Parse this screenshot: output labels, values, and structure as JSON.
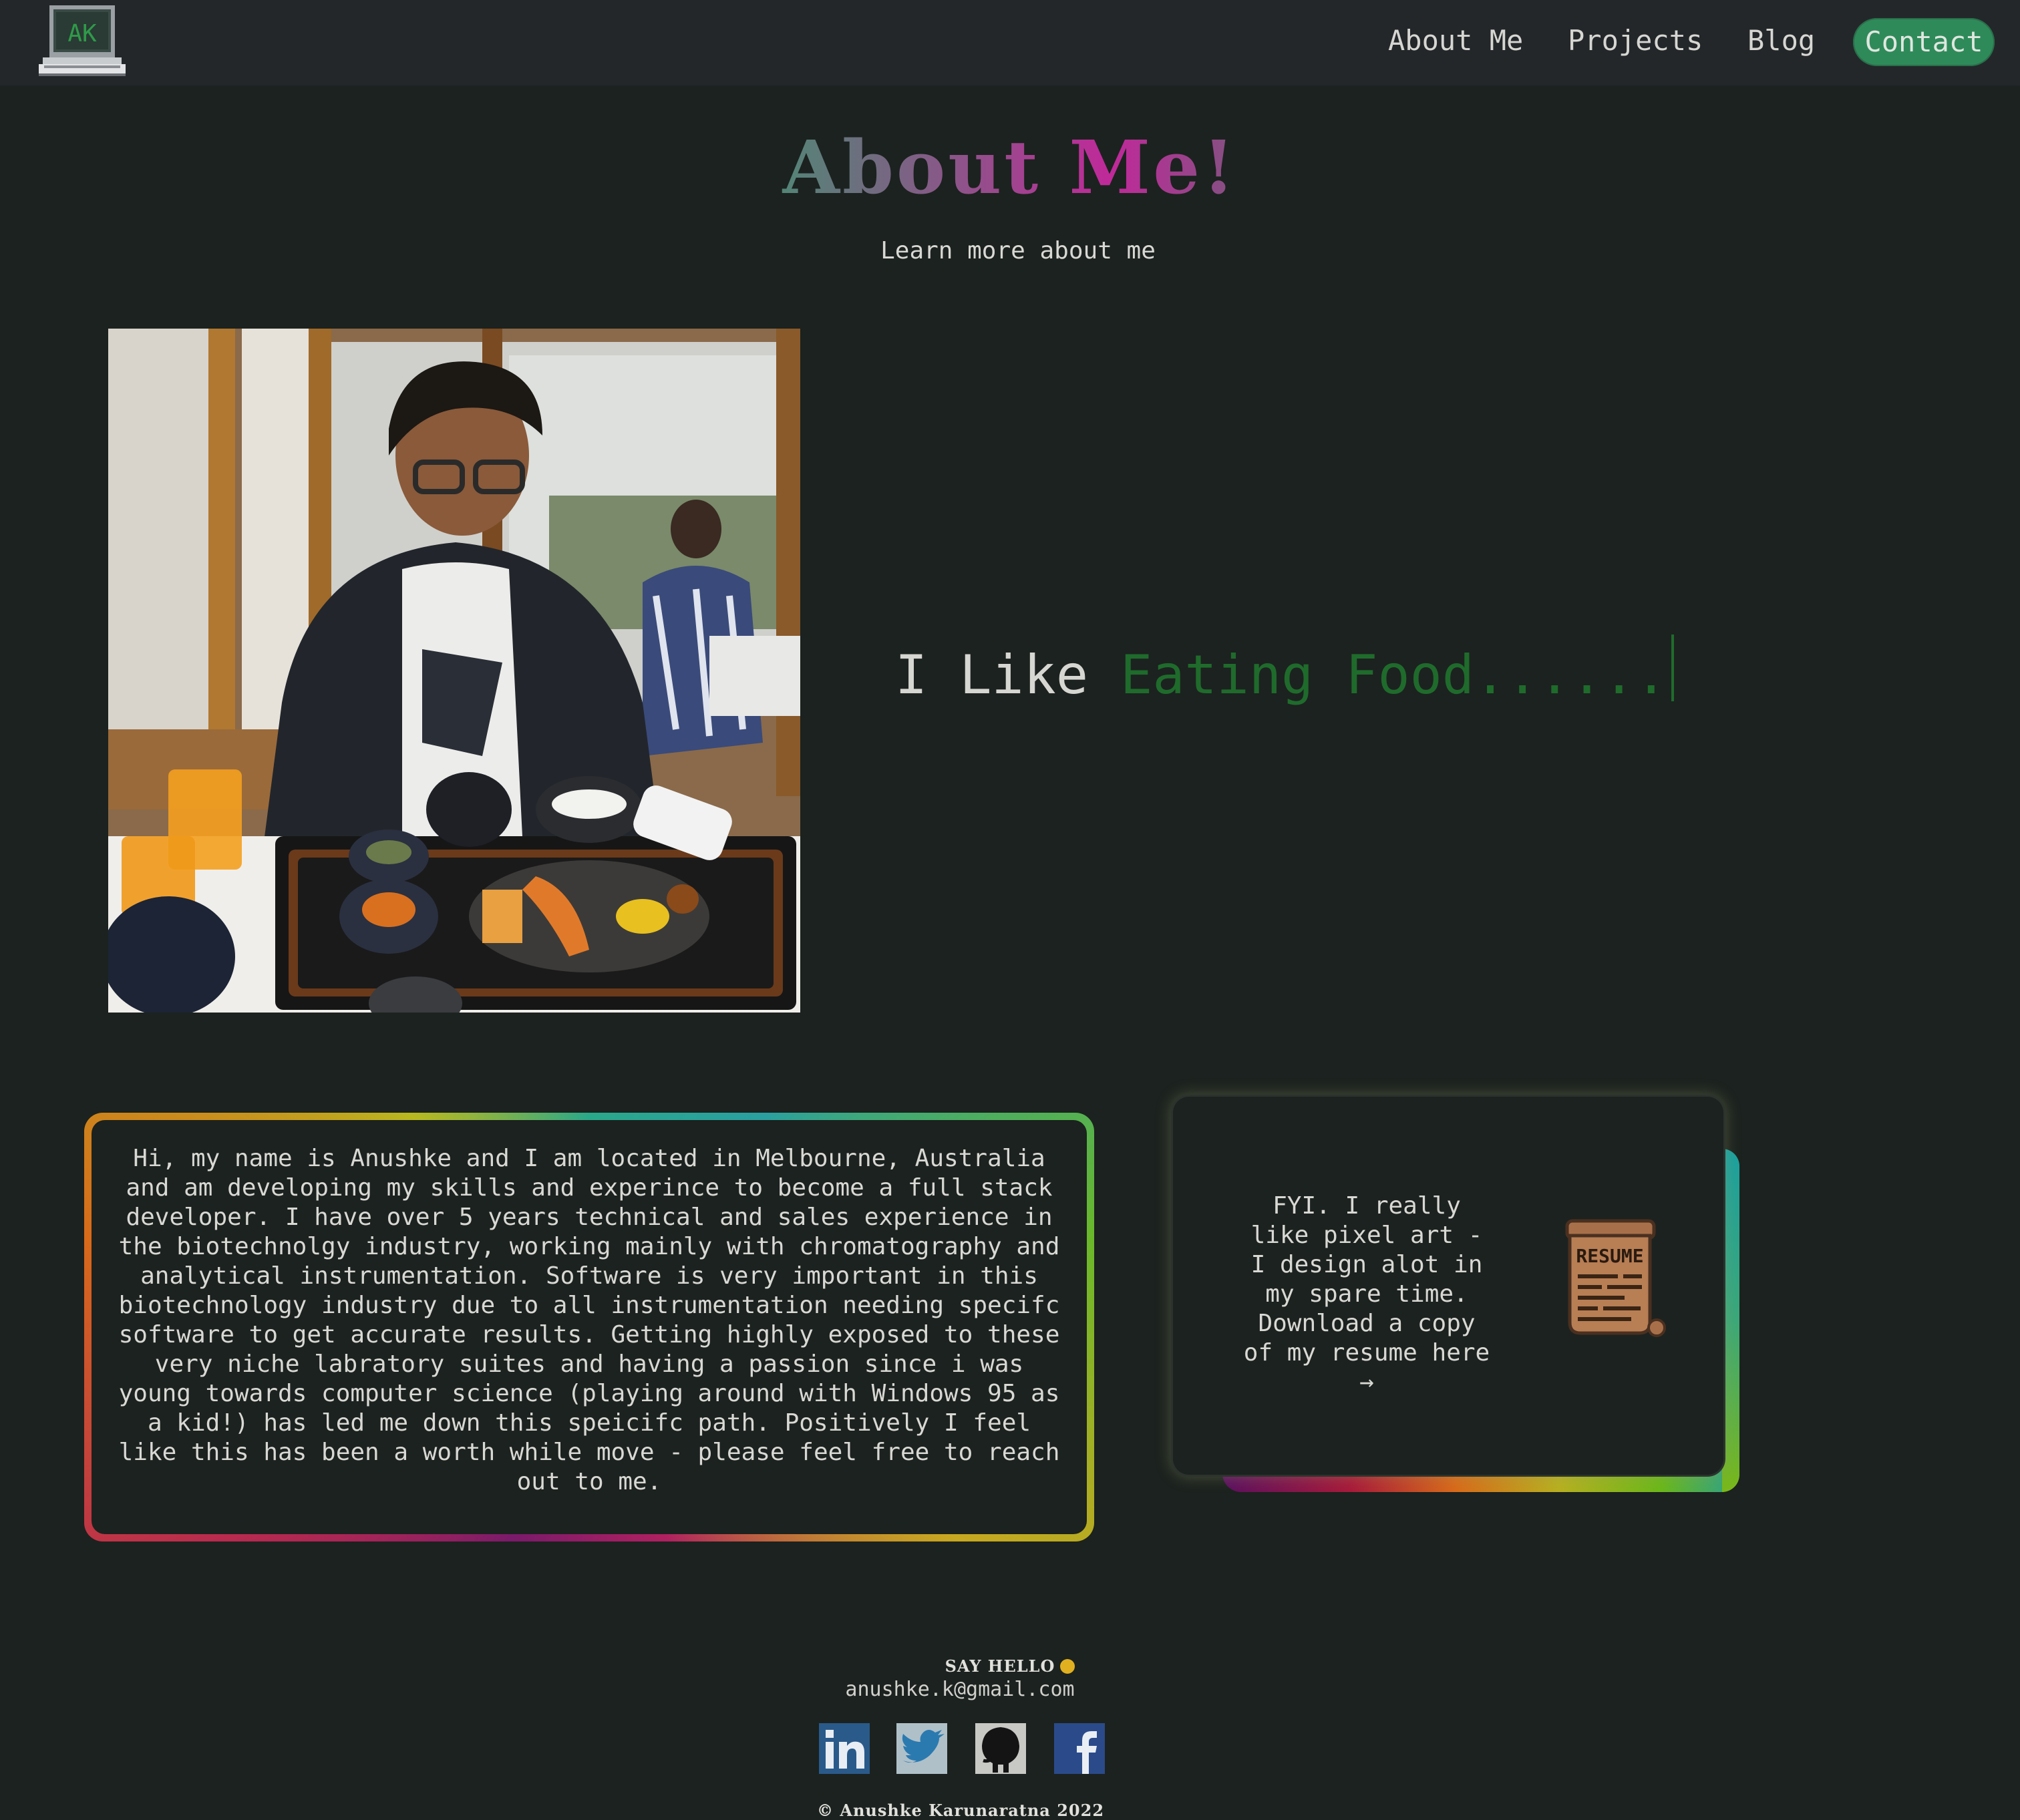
{
  "nav": {
    "logo_text": "AK",
    "links": [
      "About Me",
      "Projects",
      "Blog"
    ],
    "contact_label": "Contact"
  },
  "header": {
    "title": "About Me!",
    "subtitle": "Learn more about me"
  },
  "hero": {
    "typing_static": "I Like ",
    "typing_word": "Eating Food......"
  },
  "bio": {
    "text": "Hi, my name is Anushke and I am located in Melbourne, Australia and am developing my skills and experince to become a full stack developer. I have over 5 years technical and sales experience in the biotechnolgy industry, working mainly with chromatography and analytical instrumentation. Software is very important in this biotechnology industry due to all instrumentation needing specifc software to get accurate results. Getting highly exposed to these very niche labratory suites and having a passion since i was young towards computer science (playing around with Windows 95 as a kid!) has led me down this speicifc path. Positively I feel like this has been a worth while move - please feel free to reach out to me."
  },
  "resume": {
    "text": "FYI. I really like pixel art - I design alot in my spare time. Download a copy of my resume here →",
    "icon_text": "RESUME"
  },
  "footer": {
    "say_hello": "SAY HELLO",
    "email": "anushke.k@gmail.com",
    "socials": [
      "linkedin-icon",
      "twitter-icon",
      "github-icon",
      "facebook-icon"
    ],
    "copyright": "© Anushke Karunaratna 2022"
  },
  "colors": {
    "background": "#1c221f",
    "nav_background": "#23272a",
    "contact_button": "#2f8a5a",
    "typing_accent": "#1f6b2c",
    "title_pink": "#c0299a",
    "title_green": "#3a9a6e"
  }
}
